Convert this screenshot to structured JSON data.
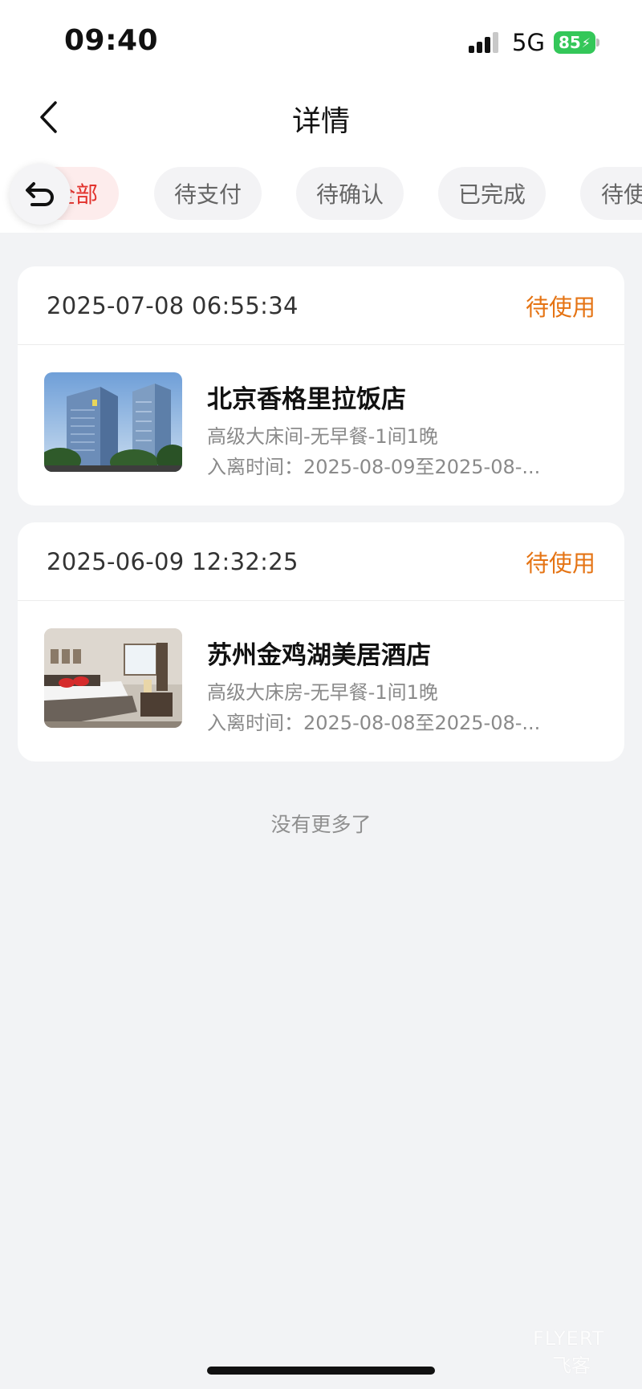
{
  "status_bar": {
    "time": "09:40",
    "network": "5G",
    "battery": "85"
  },
  "nav": {
    "title": "详情"
  },
  "tabs": [
    {
      "label": "全部",
      "active": true
    },
    {
      "label": "待支付",
      "active": false
    },
    {
      "label": "待确认",
      "active": false
    },
    {
      "label": "已完成",
      "active": false
    },
    {
      "label": "待使用",
      "active": false
    }
  ],
  "orders": [
    {
      "time": "2025-07-08 06:55:34",
      "status": "待使用",
      "hotel_name": "北京香格里拉饭店",
      "room": "高级大床间-无早餐-1间1晚",
      "stay": "入离时间：2025-08-09至2025-08-...",
      "image_icon": "hotel-exterior-photo"
    },
    {
      "time": "2025-06-09 12:32:25",
      "status": "待使用",
      "hotel_name": "苏州金鸡湖美居酒店",
      "room": "高级大床房-无早餐-1间1晚",
      "stay": "入离时间：2025-08-08至2025-08-...",
      "image_icon": "hotel-room-photo"
    }
  ],
  "footer": {
    "no_more": "没有更多了"
  },
  "watermark": {
    "en": "FLYERT",
    "cn": "飞客"
  },
  "colors": {
    "accent_red": "#e2322d",
    "status_orange": "#e57414",
    "battery_green": "#34c759"
  }
}
